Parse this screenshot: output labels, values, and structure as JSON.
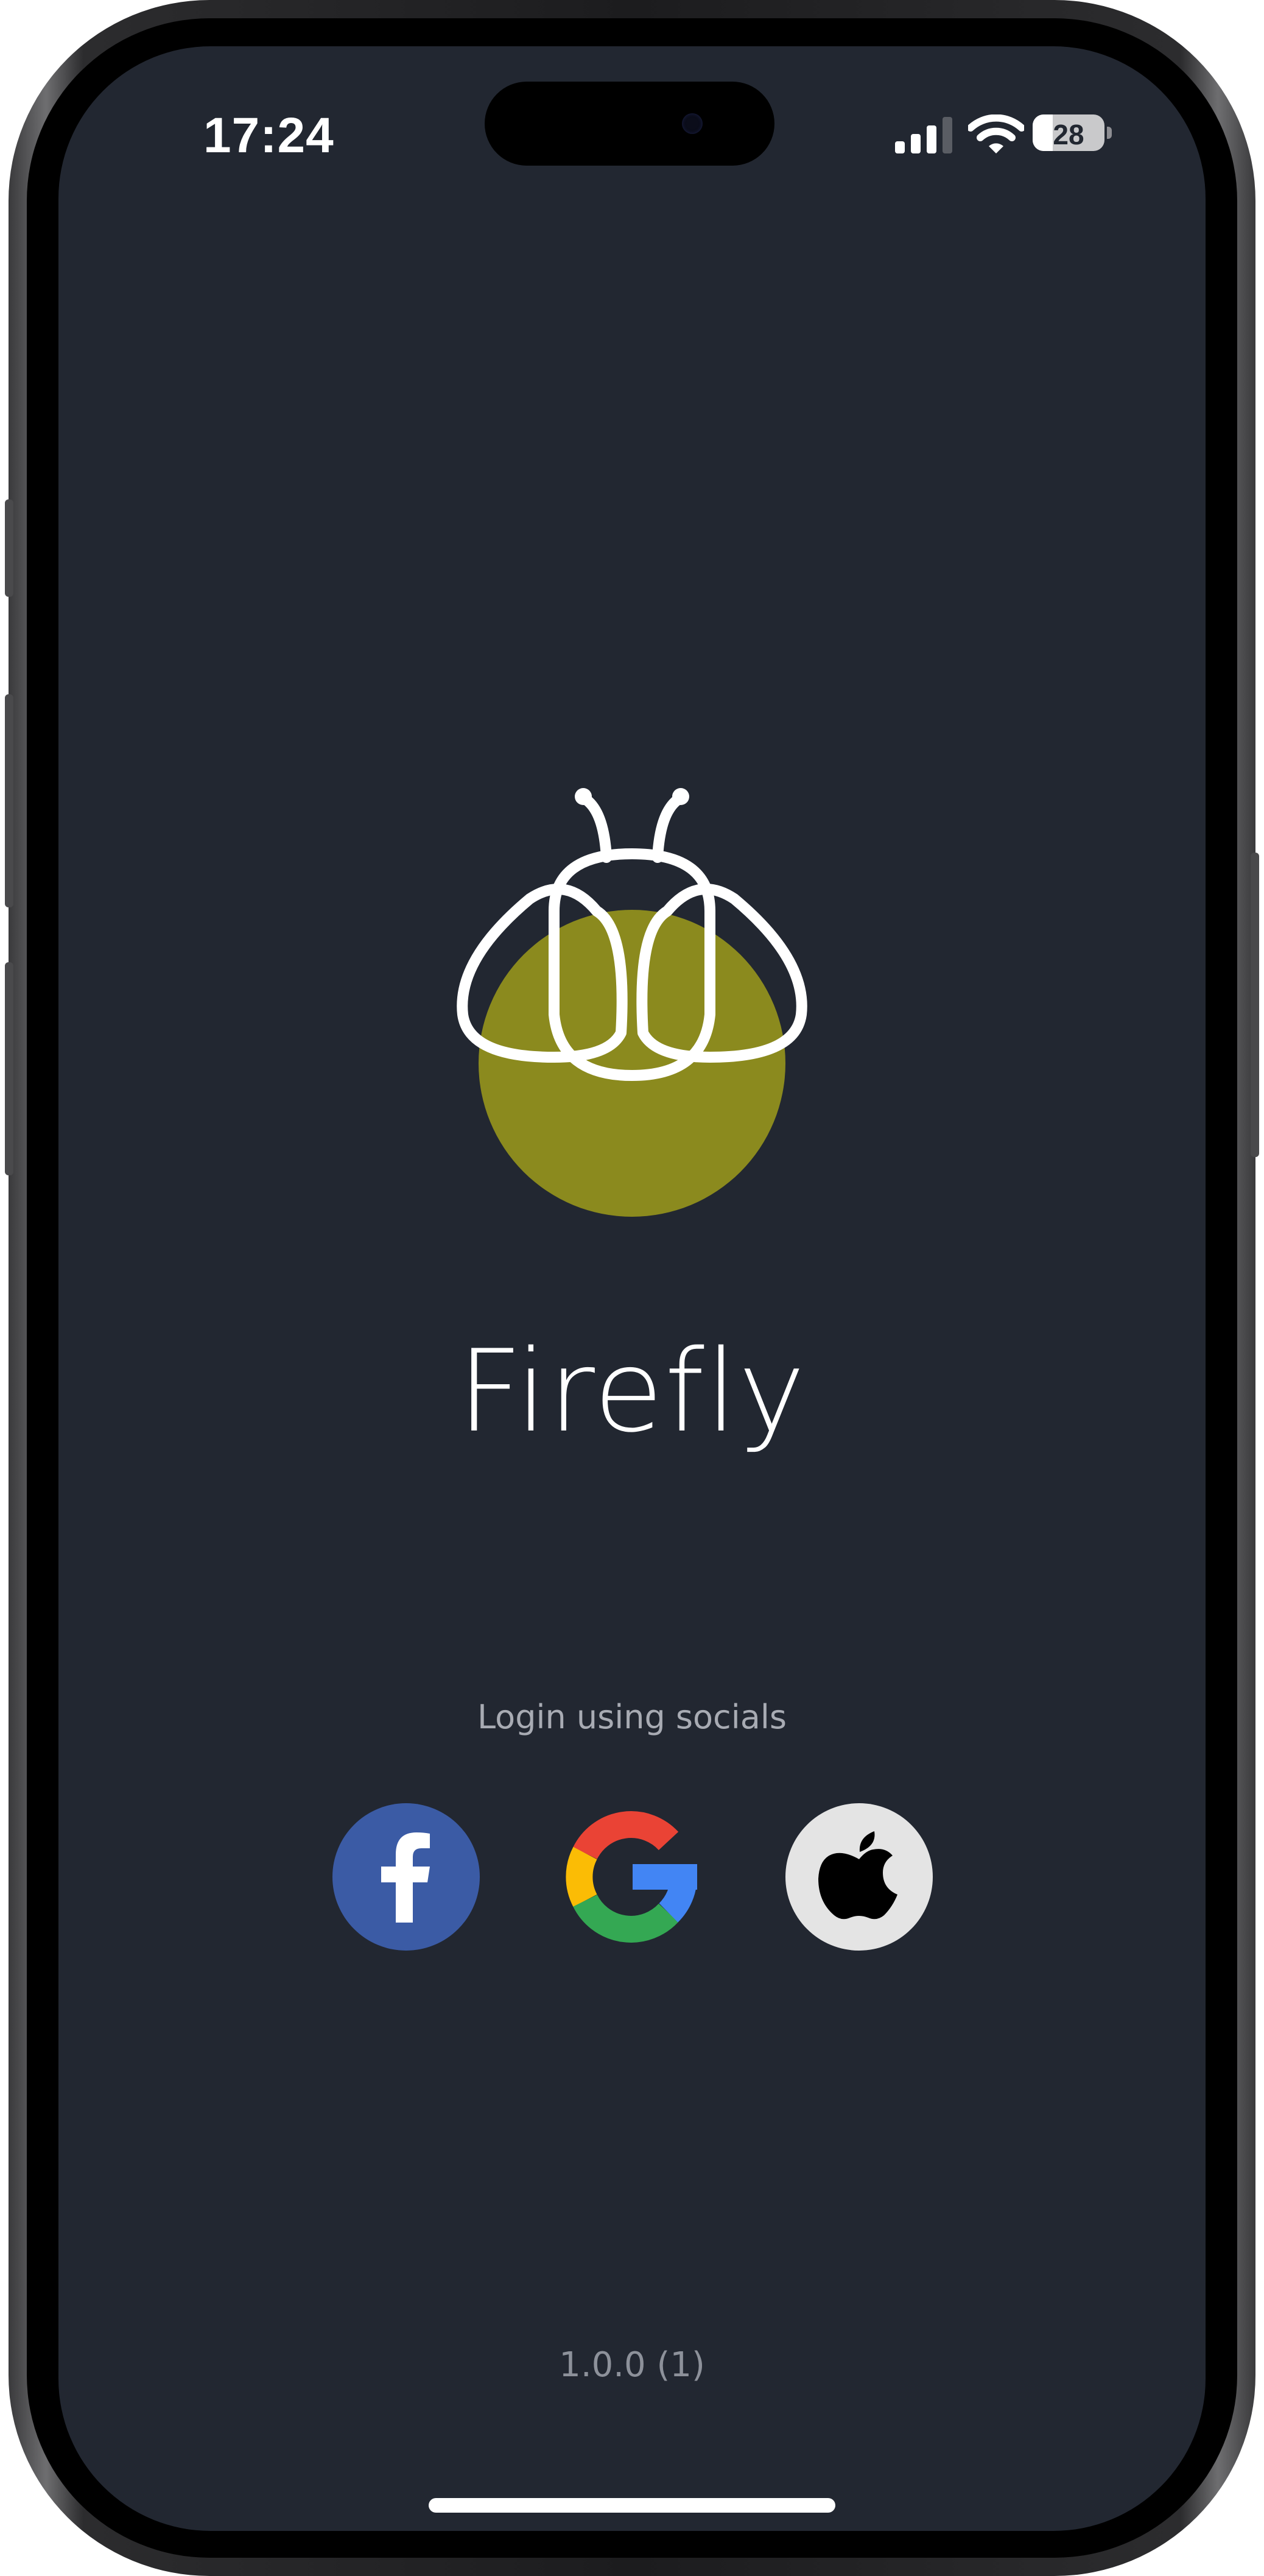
{
  "status_bar": {
    "time": "17:24",
    "battery_level": "28",
    "battery_fraction": 0.28
  },
  "app": {
    "title": "Firefly",
    "accent_color": "#8b8a1e",
    "background_color": "#222731"
  },
  "login": {
    "caption": "Login using socials",
    "providers": [
      {
        "name": "facebook",
        "icon": "facebook-icon",
        "color": "#3b5ba5"
      },
      {
        "name": "google",
        "icon": "google-icon"
      },
      {
        "name": "apple",
        "icon": "apple-icon",
        "color": "#e4e4e4"
      }
    ]
  },
  "footer": {
    "version": "1.0.0 (1)"
  }
}
